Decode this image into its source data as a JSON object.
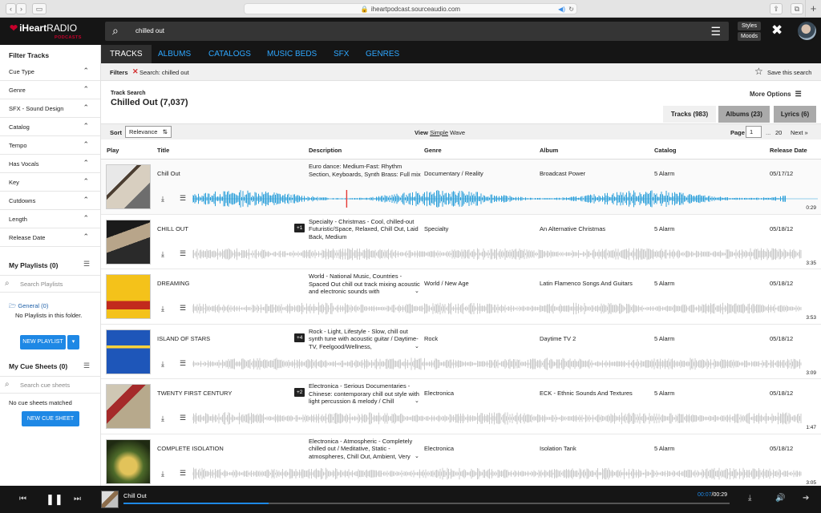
{
  "browser": {
    "url": "iheartpodcast.sourceaudio.com"
  },
  "header": {
    "brand": "iHeart",
    "brand2": "RADIO",
    "sub": "PODCASTS",
    "search_value": "chilled out",
    "styles": "Styles",
    "moods": "Moods"
  },
  "tabs": [
    "TRACKS",
    "ALBUMS",
    "CATALOGS",
    "MUSIC BEDS",
    "SFX",
    "GENRES"
  ],
  "filters": {
    "label": "Filters",
    "active": "Search: chilled out",
    "save": "Save this search"
  },
  "results": {
    "label": "Track Search",
    "title": "Chilled Out (7,037)",
    "more": "More Options",
    "tracks": "Tracks (983)",
    "albums": "Albums (23)",
    "lyrics": "Lyrics (6)"
  },
  "sort": {
    "label": "Sort",
    "value": "Relevance",
    "view_label": "View",
    "view_simple": "Simple",
    "view_wave": "Wave",
    "page_label": "Page",
    "page": "1",
    "ellipsis": "...",
    "last": "20",
    "next": "Next »"
  },
  "columns": {
    "play": "Play",
    "title": "Title",
    "description": "Description",
    "genre": "Genre",
    "album": "Album",
    "catalog": "Catalog",
    "date": "Release Date"
  },
  "sidebar": {
    "filter_title": "Filter Tracks",
    "filters": [
      "Cue Type",
      "Genre",
      "SFX - Sound Design",
      "Catalog",
      "Tempo",
      "Has Vocals",
      "Key",
      "Cutdowns",
      "Length",
      "Release Date"
    ],
    "playlists_title": "My Playlists (0)",
    "search_playlists": "Search Playlists",
    "folder": "General (0)",
    "no_playlists": "No Playlists in this folder.",
    "new_playlist": "NEW PLAYLIST",
    "cues_title": "My Cue Sheets (0)",
    "search_cues": "Search cue sheets",
    "no_cues": "No cue sheets matched",
    "new_cue": "NEW CUE SHEET"
  },
  "tracks": [
    {
      "title": "Chill Out",
      "badge": "",
      "desc": "Euro dance: Medium-Fast: Rhythm Section, Keyboards, Synth Brass: Full mix",
      "genre": "Documentary / Reality",
      "album": "Broadcast Power",
      "catalog": "5 Alarm",
      "date": "05/17/12",
      "dur": "0:29",
      "progress": 0.26
    },
    {
      "title": "CHILL OUT",
      "badge": "+1",
      "desc": "Specialty - Christmas - Cool, chilled-out Futuristic/Space, Relaxed, Chill Out, Laid Back, Medium",
      "genre": "Specialty",
      "album": "An Alternative Christmas",
      "catalog": "5 Alarm",
      "date": "05/18/12",
      "dur": "3:35",
      "progress": 0
    },
    {
      "title": "DREAMING",
      "badge": "",
      "desc": "World - National Music, Countries - Spaced Out chill out track mixing acoustic and electronic sounds with",
      "genre": "World / New Age",
      "album": "Latin Flamenco Songs And Guitars",
      "catalog": "5 Alarm",
      "date": "05/18/12",
      "dur": "3:53",
      "progress": 0
    },
    {
      "title": "ISLAND OF STARS",
      "badge": "+4",
      "desc": "Rock - Light, Lifestyle - Slow, chill out synth tune with acoustic guitar / Daytime-TV, Feelgood/Wellness,",
      "genre": "Rock",
      "album": "Daytime TV 2",
      "catalog": "5 Alarm",
      "date": "05/18/12",
      "dur": "3:09",
      "progress": 0
    },
    {
      "title": "TWENTY FIRST CENTURY",
      "badge": "+2",
      "desc": "Electronica - Serious Documentaries - Chinese: contemporary chill out style with light percussion & melody / Chill",
      "genre": "Electronica",
      "album": "ECK - Ethnic Sounds And Textures",
      "catalog": "5 Alarm",
      "date": "05/18/12",
      "dur": "1:47",
      "progress": 0
    },
    {
      "title": "COMPLETE ISOLATION",
      "badge": "",
      "desc": "Electronica - Atmospheric - Completely chilled out / Meditative, Static - atmospheres, Chill Out, Ambient, Very",
      "genre": "Electronica",
      "album": "Isolation Tank",
      "catalog": "5 Alarm",
      "date": "05/18/12",
      "dur": "3:05",
      "progress": 0
    }
  ],
  "player": {
    "title": "Chill Out",
    "elapsed": "00:07",
    "total": "/00:29",
    "progress": 0.24
  },
  "colors": {
    "accent": "#1e88e5",
    "brand": "#c6002b",
    "wave_active": "#2b9fd9",
    "wave_idle": "#c9c9c9"
  }
}
